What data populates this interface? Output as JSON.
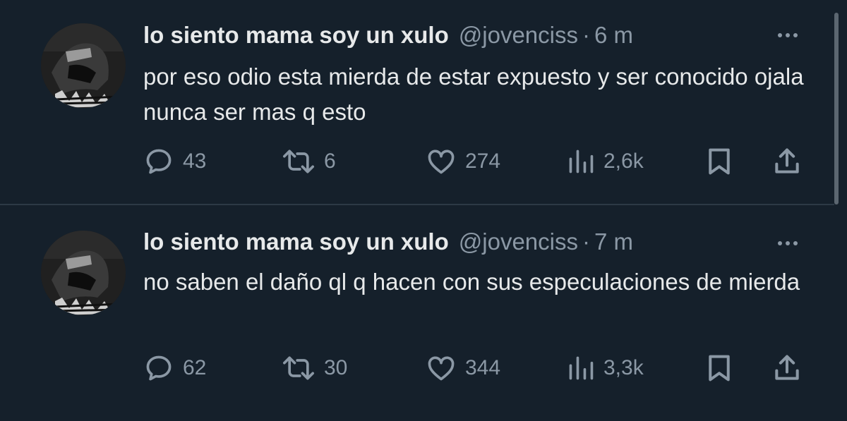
{
  "colors": {
    "background": "#15202b",
    "text_primary": "#e7e9ea",
    "text_secondary": "#8b98a5",
    "divider": "#2c3945"
  },
  "tweets": [
    {
      "display_name": "lo siento mama soy un xulo",
      "handle": "@jovenciss",
      "separator": "·",
      "time": "6 m",
      "text": "por eso odio esta mierda de estar expuesto y ser conocido ojala nunca ser mas q esto",
      "replies": "43",
      "retweets": "6",
      "likes": "274",
      "views": "2,6k",
      "icons": [
        "reply-icon",
        "retweet-icon",
        "like-icon",
        "views-icon",
        "bookmark-icon",
        "share-icon",
        "more-icon"
      ]
    },
    {
      "display_name": "lo siento mama soy un xulo",
      "handle": "@jovenciss",
      "separator": "·",
      "time": "7 m",
      "text": "no saben el daño ql q hacen con sus especulaciones de mierda",
      "replies": "62",
      "retweets": "30",
      "likes": "344",
      "views": "3,3k",
      "icons": [
        "reply-icon",
        "retweet-icon",
        "like-icon",
        "views-icon",
        "bookmark-icon",
        "share-icon",
        "more-icon"
      ]
    }
  ]
}
